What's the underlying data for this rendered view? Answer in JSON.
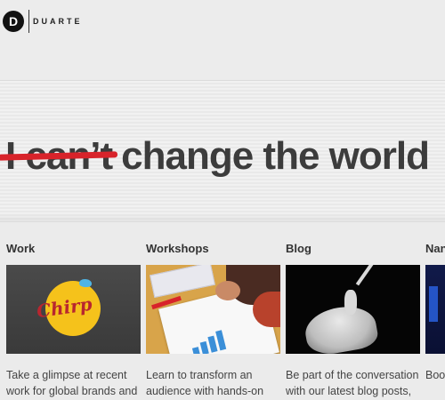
{
  "header": {
    "logo_letter": "D",
    "brand_name": "DUARTE"
  },
  "hero": {
    "struck_text": "I can’t",
    "headline_rest": "change the world"
  },
  "sections": [
    {
      "title": "Work",
      "description": "Take a glimpse at recent work for global brands and thought leaders",
      "image_text": "Chirp"
    },
    {
      "title": "Workshops",
      "description": "Learn to transform an audience with hands-on VisualStory™ training"
    },
    {
      "title": "Blog",
      "description": "Be part of the conversation with our latest blog posts, tweets and videos"
    },
    {
      "title": "Nan",
      "description": "Book engag"
    }
  ],
  "colors": {
    "accent_red": "#d8232a",
    "headline_gray": "#3c3c3c",
    "background": "#ebebeb"
  }
}
